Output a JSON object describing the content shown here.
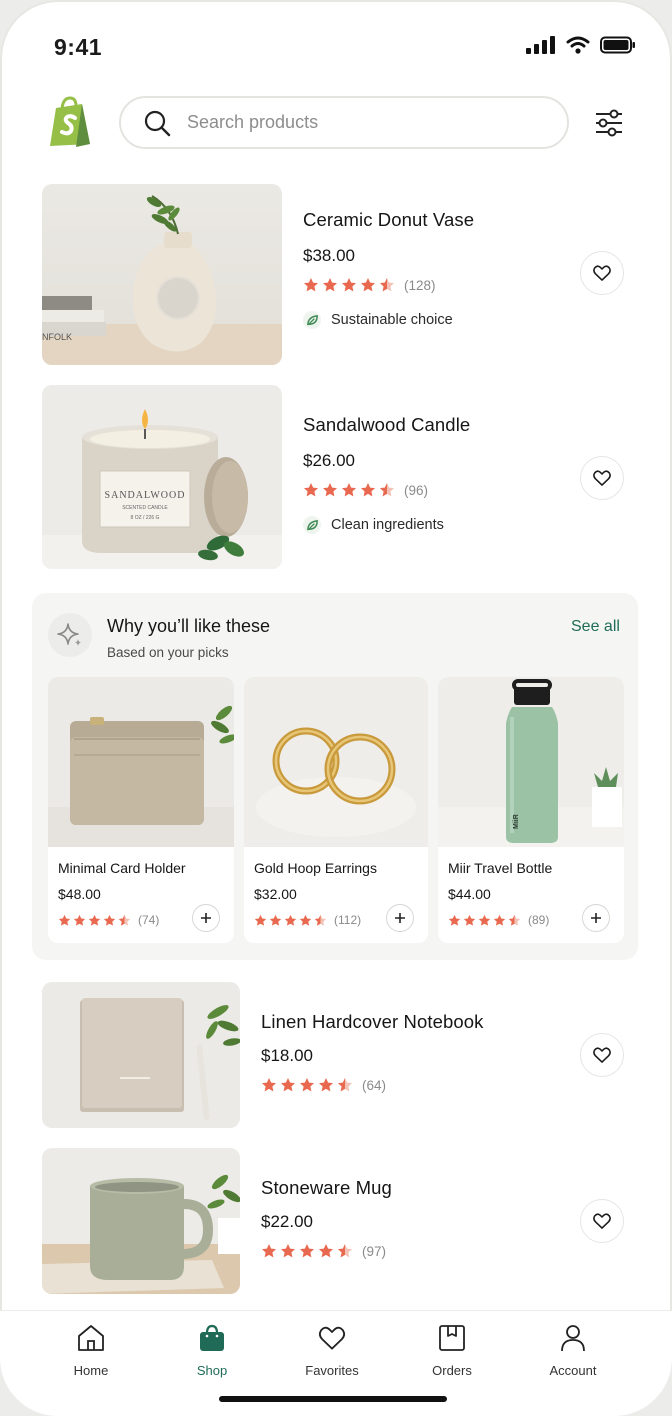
{
  "status": {
    "time": "9:41"
  },
  "search": {
    "placeholder": "Search products"
  },
  "products": [
    {
      "name": "Ceramic Donut Vase",
      "price": "$38.00",
      "rating_count": "(128)",
      "tag": "Sustainable choice"
    },
    {
      "name": "Sandalwood Candle",
      "price": "$26.00",
      "rating_count": "(96)",
      "tag": "Clean ingredients",
      "label_line1": "SANDALWOOD",
      "label_line2": "SCENTED CANDLE",
      "label_line3": "8 OZ / 226 G"
    },
    {
      "name": "Linen Hardcover Notebook",
      "price": "$18.00",
      "rating_count": "(64)"
    },
    {
      "name": "Stoneware Mug",
      "price": "$22.00",
      "rating_count": "(97)"
    }
  ],
  "recommendations": {
    "title": "Why you’ll like these",
    "subtitle": "Based on your picks",
    "see_all": "See all",
    "items": [
      {
        "name": "Minimal Card Holder",
        "price": "$48.00",
        "rating_count": "(74)"
      },
      {
        "name": "Gold Hoop Earrings",
        "price": "$32.00",
        "rating_count": "(112)"
      },
      {
        "name": "Miir Travel Bottle",
        "price": "$44.00",
        "rating_count": "(89)",
        "bottle_text": "MiiR"
      }
    ]
  },
  "book_text": "NFOLK",
  "nav": [
    {
      "label": "Home",
      "icon": "home-icon"
    },
    {
      "label": "Shop",
      "icon": "shopping-bag-icon",
      "active": true
    },
    {
      "label": "Favorites",
      "icon": "heart-icon"
    },
    {
      "label": "Orders",
      "icon": "box-icon"
    },
    {
      "label": "Account",
      "icon": "person-icon"
    }
  ],
  "colors": {
    "accent": "#1f6b57",
    "star": "#e8694f",
    "logo": "#95bf47"
  }
}
